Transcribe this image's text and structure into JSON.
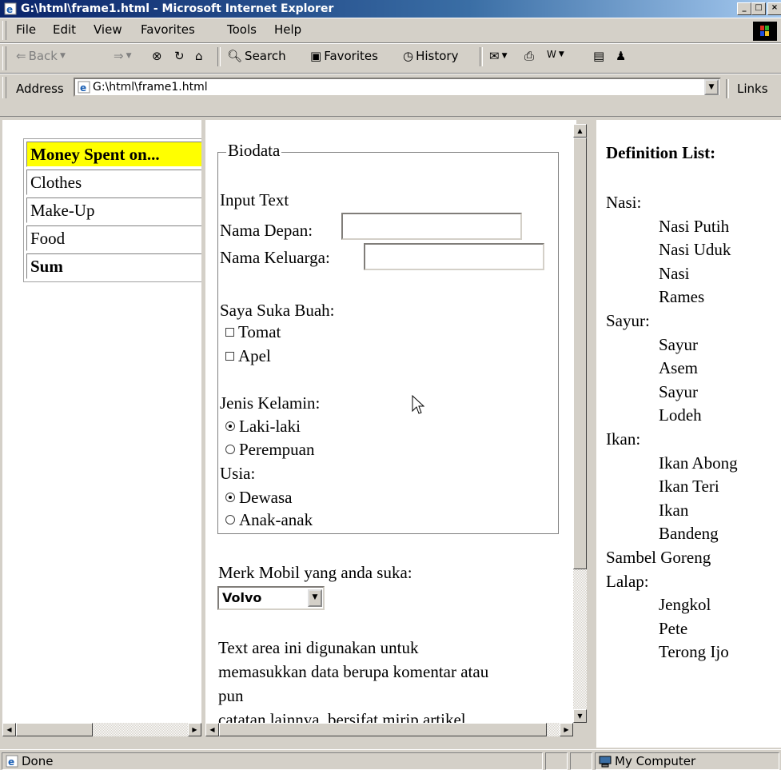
{
  "window": {
    "title": "G:\\html\\frame1.html - Microsoft Internet Explorer",
    "caption_buttons": {
      "minimize": "_",
      "maximize": "□",
      "close": "×"
    }
  },
  "menu": [
    "File",
    "Edit",
    "View",
    "Favorites",
    "Tools",
    "Help"
  ],
  "toolbar": {
    "back": "Back",
    "search": "Search",
    "favorites": "Favorites",
    "history": "History"
  },
  "address": {
    "label": "Address",
    "value": "G:\\html\\frame1.html",
    "links": "Links"
  },
  "left_frame": {
    "rows": [
      {
        "text": "Money Spent on...",
        "style": "highlight"
      },
      {
        "text": "Clothes",
        "style": "normal"
      },
      {
        "text": "Make-Up",
        "style": "normal"
      },
      {
        "text": "Food",
        "style": "normal"
      },
      {
        "text": "Sum",
        "style": "bold"
      }
    ],
    "highlight_color": "#ffff00"
  },
  "middle_frame": {
    "legend": "Biodata",
    "input_text_label": "Input Text",
    "nama_depan_label": "Nama Depan:",
    "nama_keluarga_label": "Nama Keluarga:",
    "buah_label": "Saya Suka Buah:",
    "buah_options": [
      "Tomat",
      "Apel"
    ],
    "kelamin_label": "Jenis Kelamin:",
    "kelamin_options": [
      "Laki-laki",
      "Perempuan"
    ],
    "usia_label": "Usia:",
    "usia_options": [
      "Dewasa",
      "Anak-anak"
    ],
    "mobil_label": "Merk Mobil yang anda suka:",
    "mobil_selected": "Volvo",
    "textarea_lines": [
      "Text area ini digunakan untuk",
      "memasukkan data berupa komentar atau",
      "pun",
      "catatan lainnya, bersifat mirip artikel."
    ]
  },
  "right_frame": {
    "title": "Definition List:",
    "entries": [
      {
        "term": "Nasi:",
        "defs": [
          "Nasi Putih",
          "Nasi Uduk",
          "Nasi",
          "Rames"
        ]
      },
      {
        "term": "Sayur:",
        "defs": [
          "Sayur",
          "Asem",
          "Sayur",
          "Lodeh"
        ]
      },
      {
        "term": "Ikan:",
        "defs": [
          "Ikan Abong",
          "Ikan Teri",
          "Ikan",
          "Bandeng"
        ]
      },
      {
        "term": "Sambel Goreng",
        "defs": []
      },
      {
        "term": "Lalap:",
        "defs": [
          "Jengkol",
          "Pete",
          "Terong Ijo"
        ]
      }
    ]
  },
  "status": {
    "left": "Done",
    "zone": "My Computer"
  }
}
